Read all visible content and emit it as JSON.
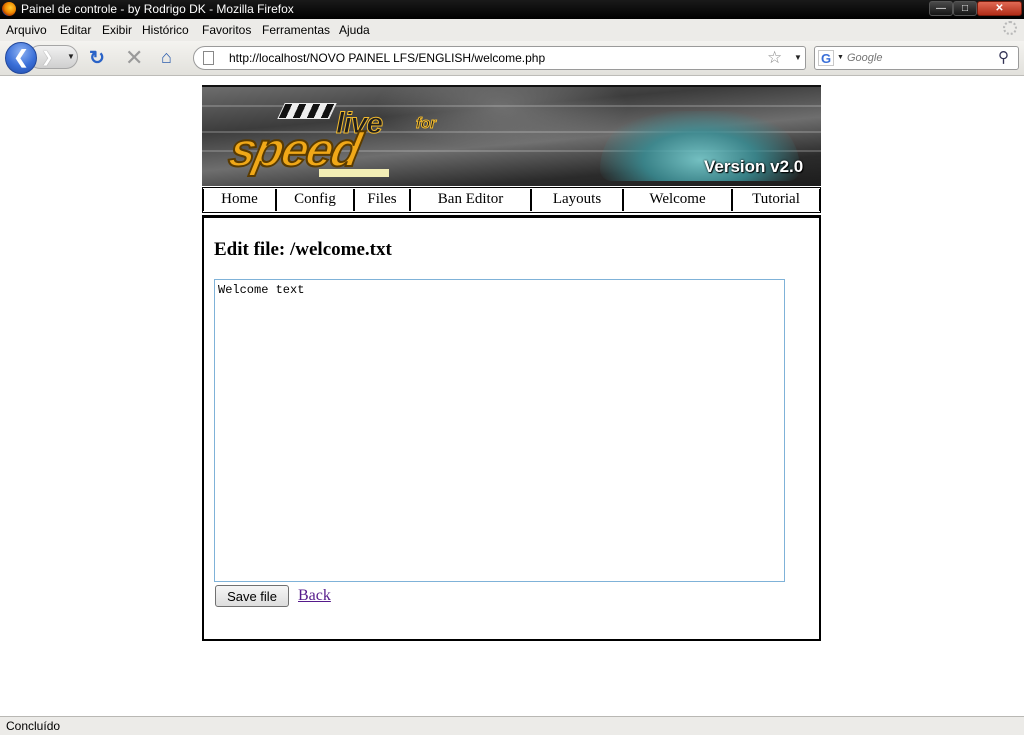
{
  "window": {
    "title": "Painel de controle - by Rodrigo DK - Mozilla Firefox",
    "min_glyph": "—",
    "max_glyph": "□",
    "close_glyph": "✕"
  },
  "menubar": {
    "items": [
      "Arquivo",
      "Editar",
      "Exibir",
      "Histórico",
      "Favoritos",
      "Ferramentas",
      "Ajuda"
    ]
  },
  "toolbar": {
    "url": "http://localhost/NOVO PAINEL LFS/ENGLISH/welcome.php",
    "search_placeholder": "Google",
    "search_engine_glyph": "G"
  },
  "banner": {
    "logo_word_1": "live",
    "logo_word_2": "for",
    "logo_word_3": "speed",
    "version": "Version v2.0"
  },
  "site_menu": {
    "items": [
      "Home",
      "Config",
      "Files",
      "Ban Editor",
      "Layouts",
      "Welcome",
      "Tutorial"
    ]
  },
  "editor": {
    "heading": "Edit file: /welcome.txt",
    "content": "Welcome text",
    "save_label": "Save file",
    "back_label": "Back"
  },
  "status": {
    "text": "Concluído"
  }
}
